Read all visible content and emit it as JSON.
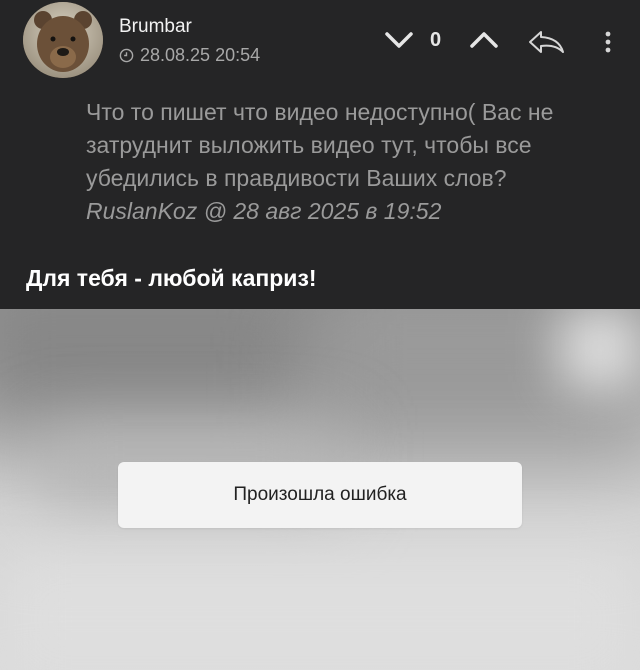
{
  "post": {
    "author": "Brumbar",
    "date": "28.08.25 20:54",
    "vote_count": "0",
    "quote": {
      "text": "Что то пишет что видео недоступно( Вас не затруднит выложить видео тут, чтобы все убедились в правдивости Ваших слов?",
      "cite": "RuslanKoz @ 28 авг 2025 в 19:52"
    },
    "body": "Для тебя - любой каприз!",
    "video": {
      "error_message": "Произошла ошибка"
    }
  },
  "icons": {
    "avatar": "bear-avatar",
    "clock": "clock-icon",
    "downvote": "chevron-down-icon",
    "upvote": "chevron-up-icon",
    "reply": "reply-arrow-icon",
    "more": "vertical-dots-icon"
  },
  "colors": {
    "background": "#252526",
    "text_primary": "#ffffff",
    "text_muted": "#9a9a9a"
  }
}
